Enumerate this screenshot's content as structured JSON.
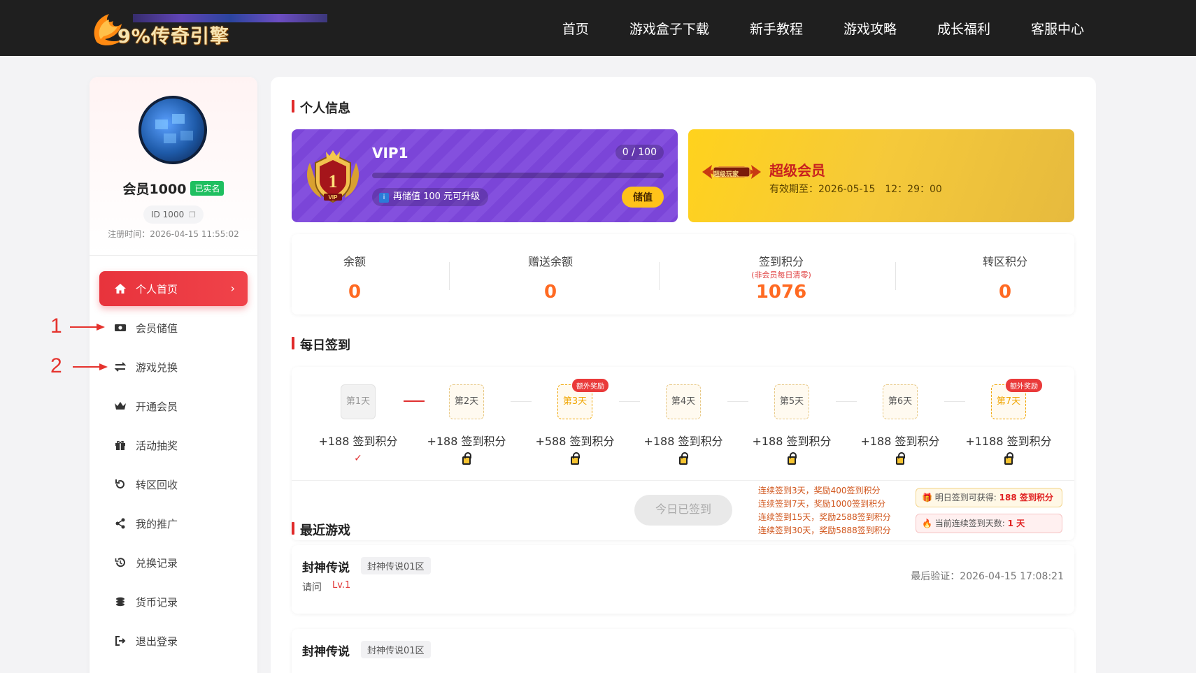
{
  "header": {
    "logo_text": "9%传奇引擎",
    "nav": [
      "首页",
      "游戏盒子下载",
      "新手教程",
      "游戏攻略",
      "成长福利",
      "客服中心"
    ]
  },
  "profile": {
    "username": "会员1000",
    "verified": "已实名",
    "id_text": "ID 1000",
    "reg_time": "注册时间：2026-04-15 11:55:02"
  },
  "menu": [
    {
      "label": "个人首页",
      "icon": "home-icon"
    },
    {
      "label": "会员储值",
      "icon": "money-icon"
    },
    {
      "label": "游戏兑换",
      "icon": "exchange-icon"
    },
    {
      "label": "开通会员",
      "icon": "crown-icon"
    },
    {
      "label": "活动抽奖",
      "icon": "gift-icon"
    },
    {
      "label": "转区回收",
      "icon": "refresh-icon"
    },
    {
      "label": "我的推广",
      "icon": "share-icon"
    },
    {
      "label": "兑换记录",
      "icon": "history-icon"
    },
    {
      "label": "货币记录",
      "icon": "coins-icon"
    },
    {
      "label": "退出登录",
      "icon": "logout-icon"
    }
  ],
  "annotations": [
    "1",
    "2"
  ],
  "sections": {
    "personal": "个人信息",
    "checkin": "每日签到",
    "recent": "最近游戏"
  },
  "vip": {
    "level": "VIP1",
    "progress_text": "0 / 100",
    "progress": 0,
    "tip": "再储值 100 元可升级",
    "recharge_btn": "储值",
    "medal_number": "1"
  },
  "super_member": {
    "badge": "超级玩家",
    "title": "超级会员",
    "expiry": "有效期至：2026-05-15　12：29：00"
  },
  "stats": [
    {
      "label": "余额",
      "value": "0",
      "sub": ""
    },
    {
      "label": "赠送余额",
      "value": "0",
      "sub": ""
    },
    {
      "label": "签到积分",
      "value": "1076",
      "sub": "(非会员每日清零)"
    },
    {
      "label": "转区积分",
      "value": "0",
      "sub": ""
    }
  ],
  "checkin": {
    "days": [
      {
        "label": "第1天",
        "reward": "+188 签到积分",
        "state": "done",
        "extra": ""
      },
      {
        "label": "第2天",
        "reward": "+188 签到积分",
        "state": "locked",
        "extra": ""
      },
      {
        "label": "第3天",
        "reward": "+588 签到积分",
        "state": "locked",
        "extra": "额外奖励"
      },
      {
        "label": "第4天",
        "reward": "+188 签到积分",
        "state": "locked",
        "extra": ""
      },
      {
        "label": "第5天",
        "reward": "+188 签到积分",
        "state": "locked",
        "extra": ""
      },
      {
        "label": "第6天",
        "reward": "+188 签到积分",
        "state": "locked",
        "extra": ""
      },
      {
        "label": "第7天",
        "reward": "+1188 签到积分",
        "state": "locked",
        "extra": "额外奖励"
      }
    ],
    "checked_mark": "✓",
    "signed_btn": "今日已签到",
    "rules": [
      "连续签到3天，奖励400签到积分",
      "连续签到7天，奖励1000签到积分",
      "连续签到15天，奖励2588签到积分",
      "连续签到30天，奖励5888签到积分"
    ],
    "tomorrow_label": "明日签到可获得: ",
    "tomorrow_value": "188 签到积分",
    "streak_label": "当前连续签到天数: ",
    "streak_value": "1 天"
  },
  "recent_games": [
    {
      "name": "封神传说",
      "zone": "封神传说01区",
      "role": "请问",
      "level": "Lv.1",
      "last": "最后验证：2026-04-15 17:08:21"
    },
    {
      "name": "封神传说",
      "zone": "封神传说01区",
      "role": "",
      "level": "",
      "last": ""
    }
  ]
}
